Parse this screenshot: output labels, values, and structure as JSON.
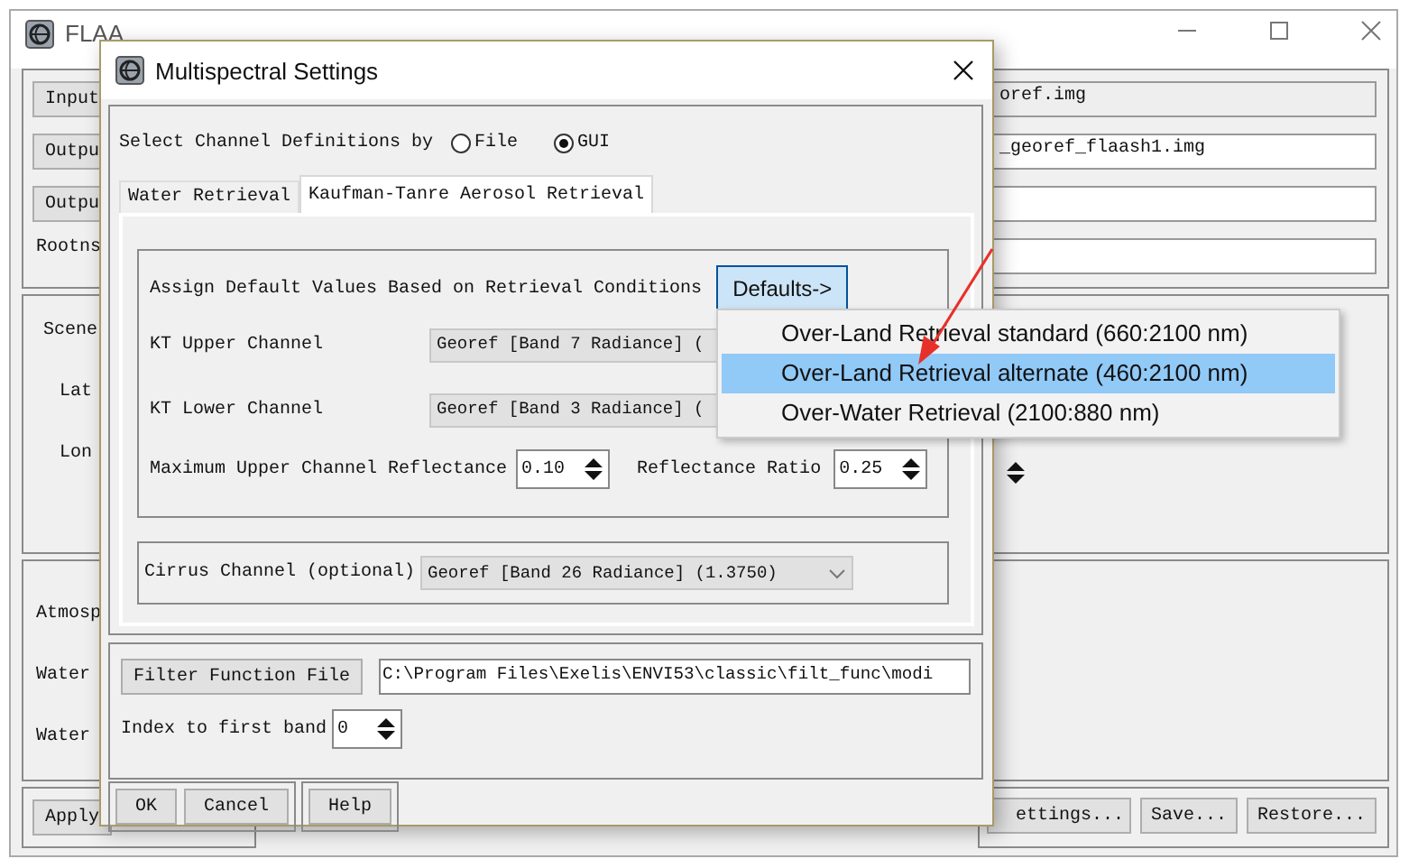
{
  "main_window": {
    "title": "FLAA",
    "left_items": [
      {
        "kind": "button",
        "text": "Input"
      },
      {
        "kind": "button",
        "text": "Outpu"
      },
      {
        "kind": "button",
        "text": "Outpu"
      },
      {
        "kind": "label",
        "text": "Rootns"
      },
      {
        "kind": "label",
        "text": "Scene"
      },
      {
        "kind": "label",
        "text": "Lat"
      },
      {
        "kind": "label",
        "text": "Lon"
      },
      {
        "kind": "label",
        "text": "Atmosp"
      },
      {
        "kind": "label",
        "text": "Water"
      },
      {
        "kind": "label",
        "text": "Water"
      }
    ],
    "apply_button": "Apply",
    "fields": [
      {
        "value": "oref.img",
        "editable": false
      },
      {
        "value": "_georef_flaash1.img",
        "editable": true
      },
      {
        "editable": true
      },
      {
        "editable": true
      }
    ],
    "bottom_buttons": [
      "ettings...",
      "Save...",
      "Restore..."
    ]
  },
  "dialog": {
    "title": "Multispectral Settings",
    "channel_definitions": {
      "label": "Select Channel Definitions by",
      "options": [
        {
          "label": "File",
          "selected": false
        },
        {
          "label": "GUI",
          "selected": true
        }
      ]
    },
    "tabs": [
      {
        "label": "Water Retrieval",
        "selected": false
      },
      {
        "label": "Kaufman-Tanre Aerosol Retrieval",
        "selected": true
      }
    ],
    "assign_label": "Assign Default Values Based on Retrieval Conditions",
    "defaults_button": {
      "label": "Defaults->",
      "pressed": true
    },
    "channels": [
      {
        "label": "KT Upper Channel",
        "value": "Georef [Band 7 Radiance] ("
      },
      {
        "label": "KT Lower Channel",
        "value": "Georef [Band 3 Radiance] ("
      }
    ],
    "max_reflectance": {
      "label": "Maximum Upper Channel Reflectance",
      "value": "0.10"
    },
    "ratio": {
      "label": "Reflectance Ratio",
      "value": "0.25"
    },
    "cirrus": {
      "label": "Cirrus Channel (optional)",
      "value": "Georef [Band 26 Radiance] (1.3750)"
    },
    "filter_button": "Filter Function File",
    "filter_path": "C:\\Program Files\\Exelis\\ENVI53\\classic\\filt_func\\modi",
    "index": {
      "label": "Index to first band",
      "value": "0"
    },
    "buttons": [
      "OK",
      "Cancel",
      "Help"
    ]
  },
  "defaults_menu": {
    "items": [
      {
        "label": "Over-Land Retrieval standard (660:2100 nm)",
        "selected": false
      },
      {
        "label": "Over-Land Retrieval alternate (460:2100 nm)",
        "selected": true
      },
      {
        "label": "Over-Water Retrieval (2100:880 nm)",
        "selected": false
      }
    ]
  }
}
